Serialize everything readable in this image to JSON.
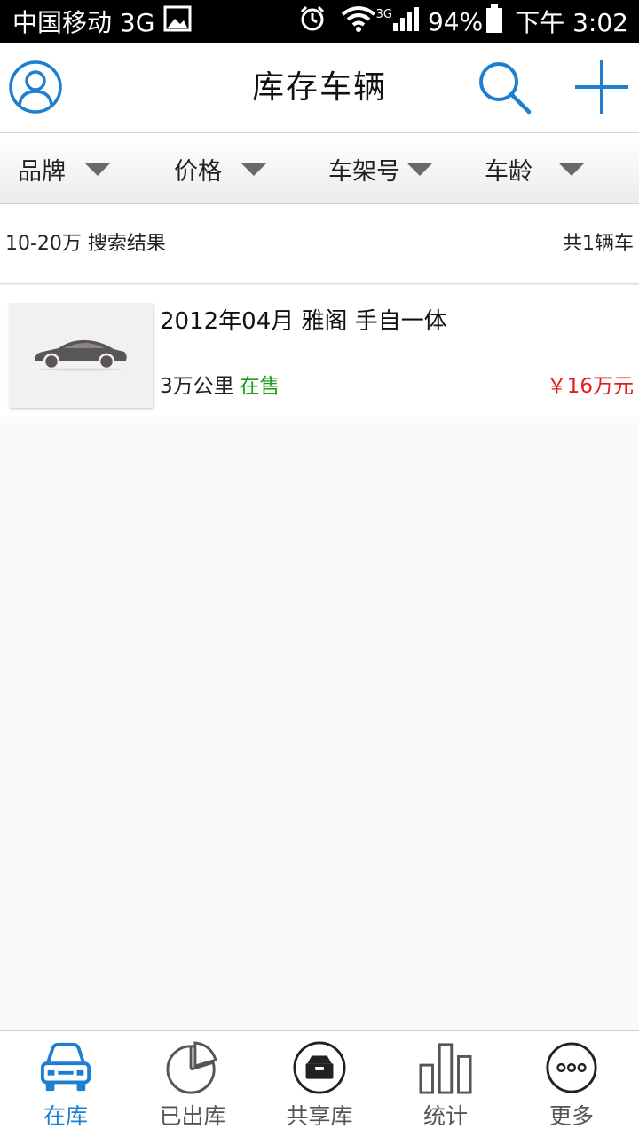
{
  "status_bar": {
    "carrier": "中国移动 3G",
    "network": "3G",
    "battery": "94%",
    "time": "下午 3:02"
  },
  "header": {
    "title": "库存车辆",
    "icons": [
      "user-icon",
      "search-icon",
      "add-icon"
    ]
  },
  "filters": [
    {
      "label": "品牌"
    },
    {
      "label": "价格"
    },
    {
      "label": "车架号"
    },
    {
      "label": "车龄"
    }
  ],
  "results": {
    "query": "10-20万 搜索结果",
    "count": "共1辆车"
  },
  "vehicles": [
    {
      "name": "2012年04月 雅阁 手自一体",
      "mileage": "3万公里",
      "status": "在售",
      "price": "￥16万元"
    }
  ],
  "tabs": [
    {
      "label": "在库",
      "icon": "car-icon",
      "active": true
    },
    {
      "label": "已出库",
      "icon": "pie-chart-icon",
      "active": false
    },
    {
      "label": "共享库",
      "icon": "box-icon",
      "active": false
    },
    {
      "label": "统计",
      "icon": "bar-chart-icon",
      "active": false
    },
    {
      "label": "更多",
      "icon": "more-icon",
      "active": false
    }
  ],
  "colors": {
    "accent": "#1e7fd0",
    "status_on_sale": "#1aa01a",
    "price": "#e31b1b"
  }
}
